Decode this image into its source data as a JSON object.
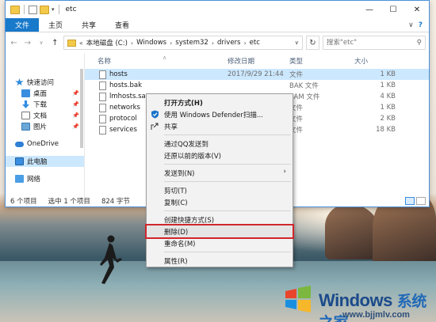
{
  "window": {
    "title": "etc",
    "controls": {
      "minimize": "—",
      "maximize": "☐",
      "close": "✕"
    }
  },
  "ribbon": {
    "tabs": [
      "文件",
      "主页",
      "共享",
      "查看"
    ],
    "collapse": "∨",
    "help": "?"
  },
  "address": {
    "crumbs": [
      "本地磁盘 (C:)",
      "Windows",
      "system32",
      "drivers",
      "etc"
    ],
    "prefix": "«",
    "search_placeholder": "搜索\"etc\""
  },
  "nav": {
    "items": [
      {
        "label": "快速访问",
        "icon": "star-icon"
      },
      {
        "label": "桌面",
        "icon": "desktop-icon",
        "pinned": true
      },
      {
        "label": "下载",
        "icon": "download-icon",
        "pinned": true
      },
      {
        "label": "文档",
        "icon": "document-icon",
        "pinned": true
      },
      {
        "label": "图片",
        "icon": "picture-icon",
        "pinned": true
      },
      {
        "label": "OneDrive",
        "icon": "cloud-icon"
      },
      {
        "label": "此电脑",
        "icon": "computer-icon"
      },
      {
        "label": "网络",
        "icon": "network-icon"
      }
    ]
  },
  "columns": {
    "name": "名称",
    "date": "修改日期",
    "type": "类型",
    "size": "大小"
  },
  "files": [
    {
      "name": "hosts",
      "date": "2017/9/29 21:44",
      "type": "文件",
      "size": "1 KB"
    },
    {
      "name": "hosts.bak",
      "date": "",
      "type": "BAK 文件",
      "size": "1 KB"
    },
    {
      "name": "lmhosts.sam",
      "date": "",
      "type": "SAM 文件",
      "size": "4 KB"
    },
    {
      "name": "networks",
      "date": "",
      "type": "文件",
      "size": "1 KB"
    },
    {
      "name": "protocol",
      "date": "",
      "type": "文件",
      "size": "2 KB"
    },
    {
      "name": "services",
      "date": "",
      "type": "文件",
      "size": "18 KB"
    }
  ],
  "status": {
    "count": "6 个项目",
    "selected": "选中 1 个项目",
    "size": "824 字节"
  },
  "context_menu": {
    "open_with": "打开方式(H)",
    "defender": "使用 Windows Defender扫描...",
    "share": "共享",
    "qq_send": "通过QQ发送到",
    "restore": "还原以前的版本(V)",
    "send_to": "发送到(N)",
    "cut": "剪切(T)",
    "copy": "复制(C)",
    "shortcut": "创建快捷方式(S)",
    "delete": "删除(D)",
    "rename": "重命名(M)",
    "properties": "属性(R)"
  },
  "watermark": {
    "brand": "Windows",
    "brand_cn": "系统之家",
    "url": "www.bjjmlv.com"
  },
  "colors": {
    "highlight_box": "#d1262b",
    "selection": "#cce8ff",
    "file_tab": "#1979ca"
  }
}
